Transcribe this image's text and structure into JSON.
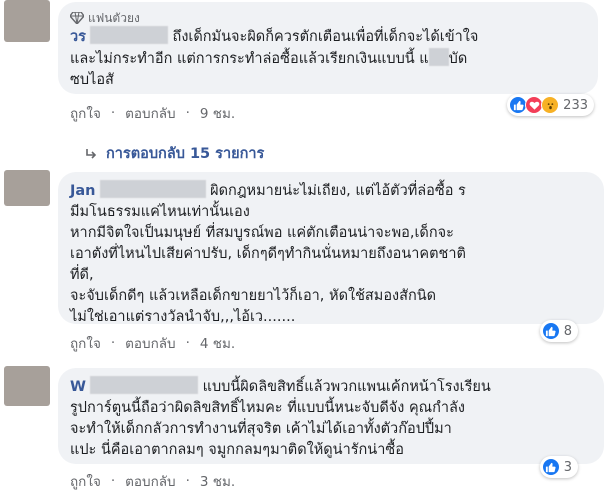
{
  "comments": [
    {
      "badge": "แฟนตัวยง",
      "name": "วร",
      "lines": [
        "ถึงเด็กมันจะผิดก็ควรตักเตือนเพื่อที่เด็กจะได้เข้าใจ",
        "และไม่กระทำอีก แต่การกระทำล่อซื้อแล้วเรียกเงินแบบนี้ แ",
        "ซบไอสั"
      ],
      "line2_tail": "บัด",
      "like": "ถูกใจ",
      "reply": "ตอบกลับ",
      "time": "9 ชม.",
      "reaction_count": "233"
    },
    {
      "name": "Jan",
      "lines": [
        "ผิดกฎหมายน่ะไม่เถียง, แต่ไอ้ตัวที่ล่อซื้อ",
        "มีมโนธรรมแค่ไหนเท่านั้นเอง",
        "หากมีจิตใจเป็นมนุษย์ ที่สมบูรณ์พอ แค่ตักเตือนน่าจะพอ,เด็กจะ",
        "เอาตังที่ไหนไปเสียค่าปรับ, เด็กๆดีๆทำกินนั่นหมายถึงอนาคตชาติ",
        "ที่ดี,",
        "จะจับเด็กดีๆ แล้วเหลือเด็กขายยาไว้ก็เอา, หัดใช้สมองสักนิด",
        "ไม่ใช่เอาแต่รางวัลนำจับ,,,ไอ้เว......."
      ],
      "line1_tail": "ร",
      "like": "ถูกใจ",
      "reply": "ตอบกลับ",
      "time": "4 ชม.",
      "reaction_count": "8"
    },
    {
      "name": "W",
      "lines": [
        "แบบนี้ผิดลิขสิทธิ์แล้วพวกแพนเค้กหน้าโรงเรียน",
        "รูปการ์ตูนนี้ถือว่าผิดลิขสิทธิ์ไหมคะ ที่แบบนี้หนะจับดีจัง คุณกำลัง",
        "จะทำให้เด็กกลัวการทำงานที่สุจริต เค้าไม่ได้เอาทั้งตัวก๊อปปี้มา",
        "แปะ นี่คือเอาตากลมๆ จมูกกลมๆมาติดให้ดูน่ารักน่าซื้อ"
      ],
      "like": "ถูกใจ",
      "reply": "ตอบกลับ",
      "time": "3 ชม.",
      "reaction_count": "3"
    }
  ],
  "replies_link": "การตอบกลับ 15 รายการ",
  "separator": "·",
  "colors": {
    "bubble": "#f0f2f5",
    "name": "#385898",
    "meta": "#65676b",
    "like_blue": "#1877f2",
    "love_red": "#f33e58",
    "wow_yellow": "#f7b125"
  }
}
